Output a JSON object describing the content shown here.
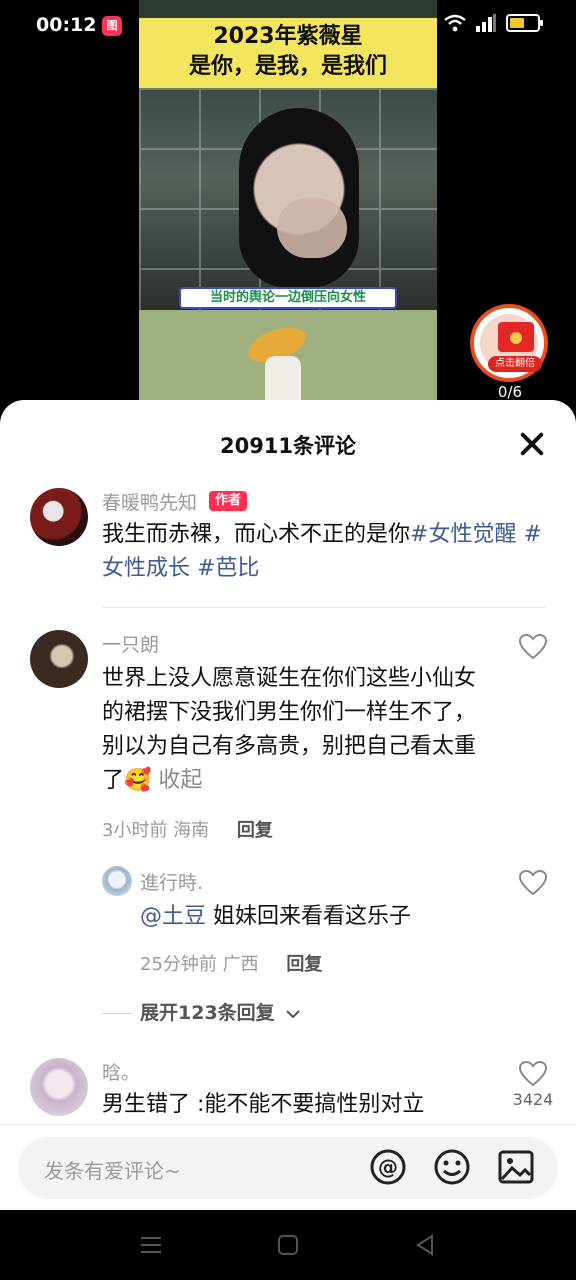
{
  "status_bar": {
    "time": "00:12",
    "app_notification": "图",
    "battery_level": 0.55,
    "icons": [
      "wifi-icon",
      "signal-icon",
      "battery-icon"
    ]
  },
  "video": {
    "banner_line1": "2023年紫薇星",
    "banner_line2": "是你，是我，是我们",
    "subtitle": "当时的舆论一边倒压向女性"
  },
  "red_packet": {
    "coin_symbol": "¥",
    "label": "点击翻倍",
    "progress": "0/6"
  },
  "comments_header": {
    "title": "20911条评论"
  },
  "comments": [
    {
      "user": "春暖鸭先知",
      "badge": "作者",
      "text": "我生而赤裸，而心术不正的是你",
      "tags": "#女性觉醒 #女性成长 #芭比"
    },
    {
      "user": "一只朗",
      "text": "世界上没人愿意诞生在你们这些小仙女的裙摆下没我们男生你们一样生不了，别以为自己有多高贵，别把自己看太重了🥰",
      "fold": "收起",
      "time": "3小时前",
      "location": "海南",
      "reply": "回复"
    },
    {
      "user": "進行時.",
      "mention": "@土豆",
      "text": "姐妹回来看看这乐子",
      "time": "25分钟前",
      "location": "广西",
      "reply": "回复"
    },
    {
      "user": "晗。",
      "text": "男生错了 :能不能不要搞性别对立",
      "likes": "3424"
    }
  ],
  "expand_replies": "展开123条回复",
  "input": {
    "placeholder": "发条有爱评论~",
    "at_icon": "@"
  }
}
